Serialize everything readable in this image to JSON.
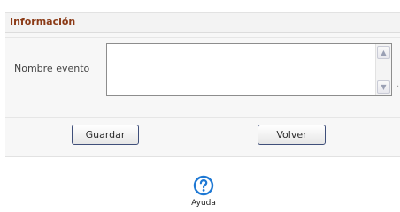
{
  "section": {
    "title": "Información"
  },
  "form": {
    "event_name_label": "Nombre evento",
    "event_name_value": "",
    "save_label": "Guardar",
    "back_label": "Volver"
  },
  "help": {
    "label": "Ayuda",
    "icon": "question-circle-icon"
  },
  "colors": {
    "section_title": "#8b3a16",
    "button_border": "#3f4f7a",
    "help_icon": "#1f79d4"
  }
}
